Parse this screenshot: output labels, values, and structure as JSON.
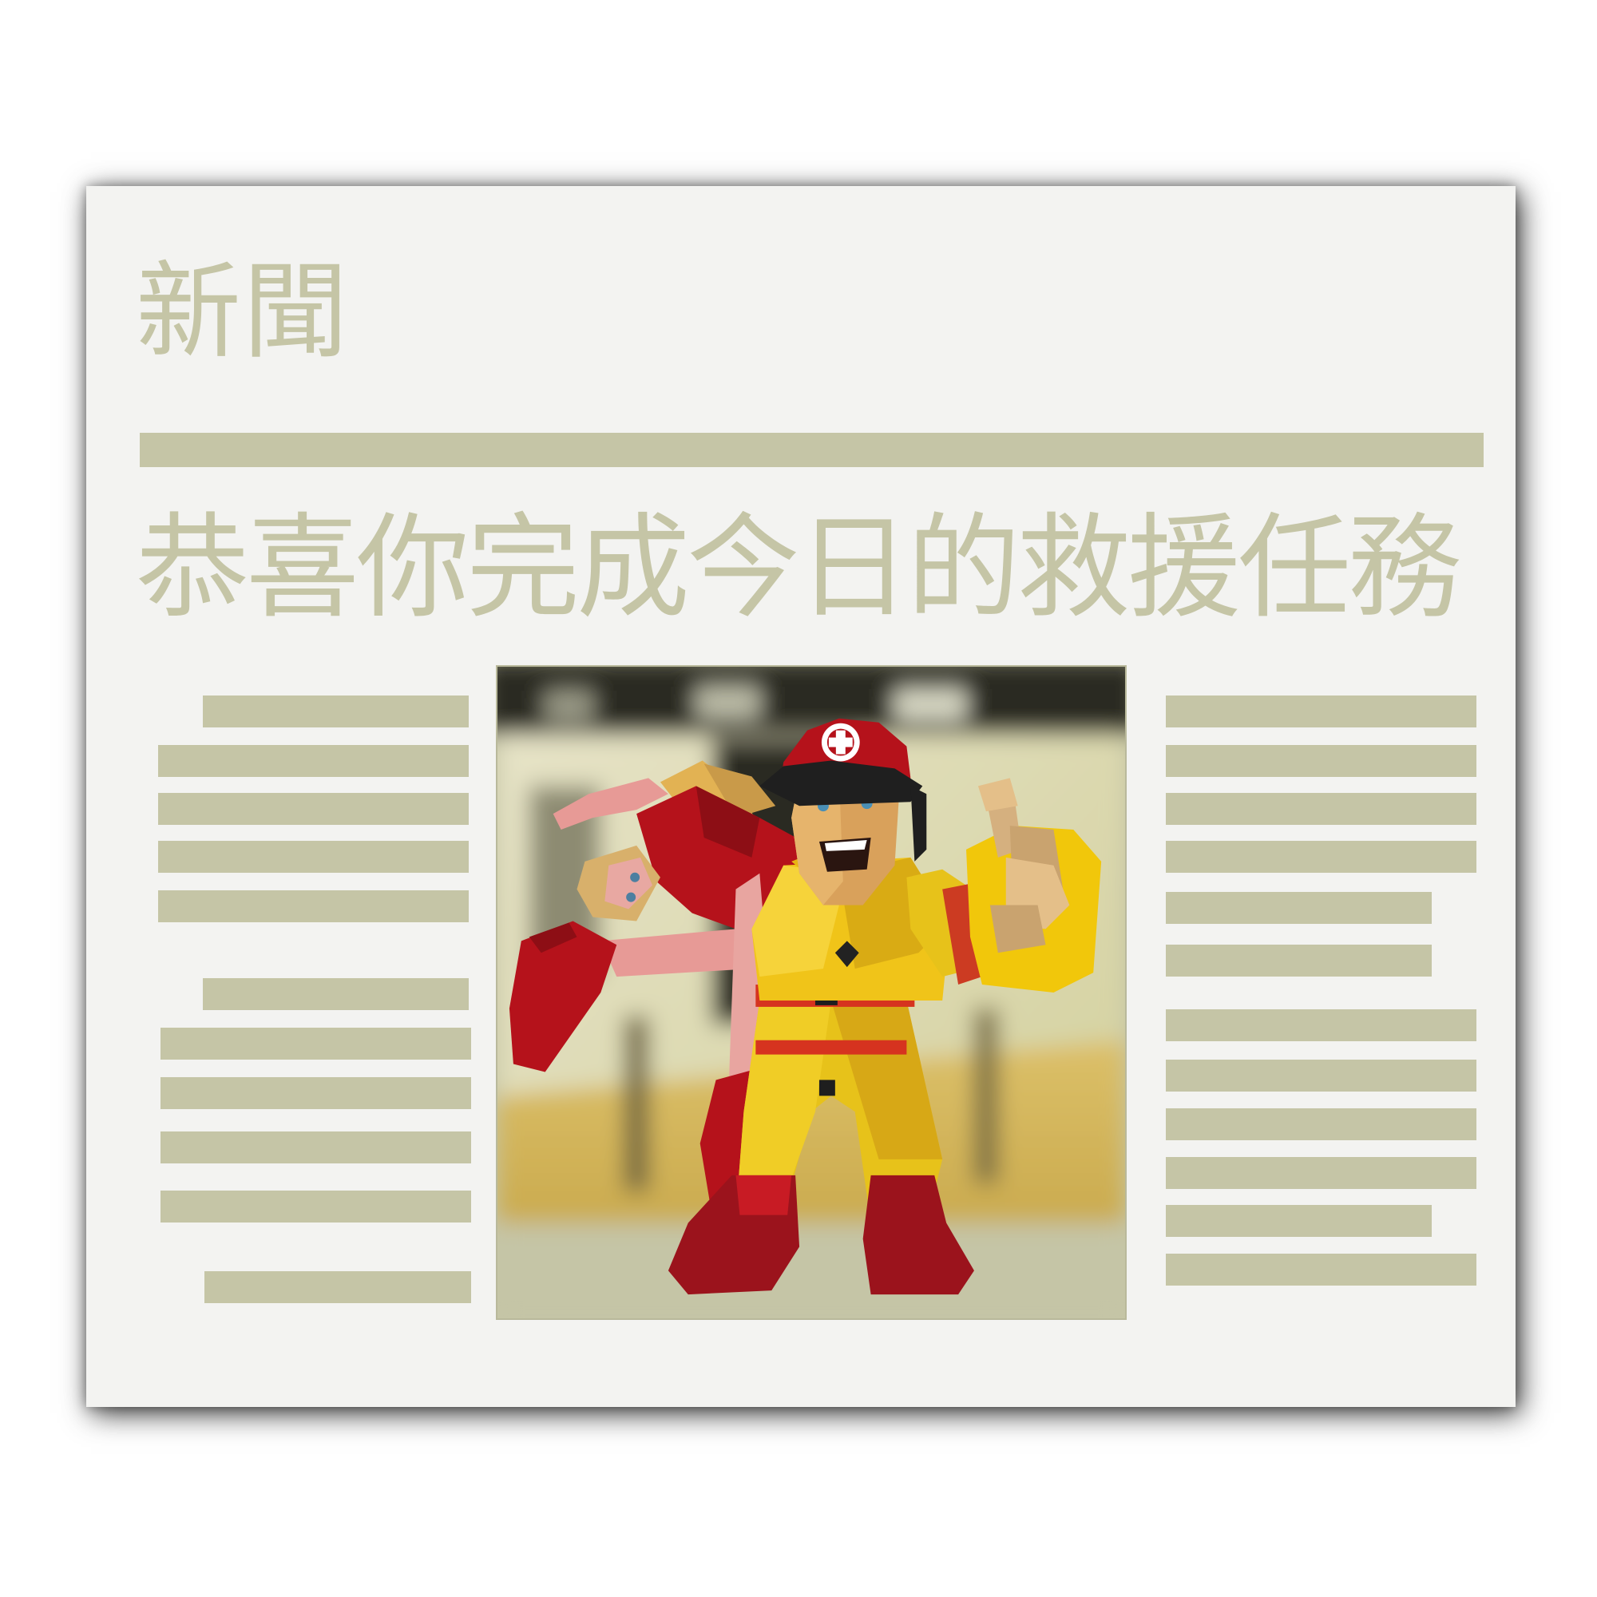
{
  "newspaper": {
    "masthead": "新聞",
    "headline": "恭喜你完成今日的救援任務"
  },
  "photo": {
    "description_icon": "firefighter-carrying-woman-thumbs-up-illustration"
  },
  "colors": {
    "paper": "#f3f3f1",
    "ink": "#c5c5a6",
    "uniform_yellow": "#f0c419",
    "uniform_red": "#b5121b",
    "background": "#ffffff"
  }
}
